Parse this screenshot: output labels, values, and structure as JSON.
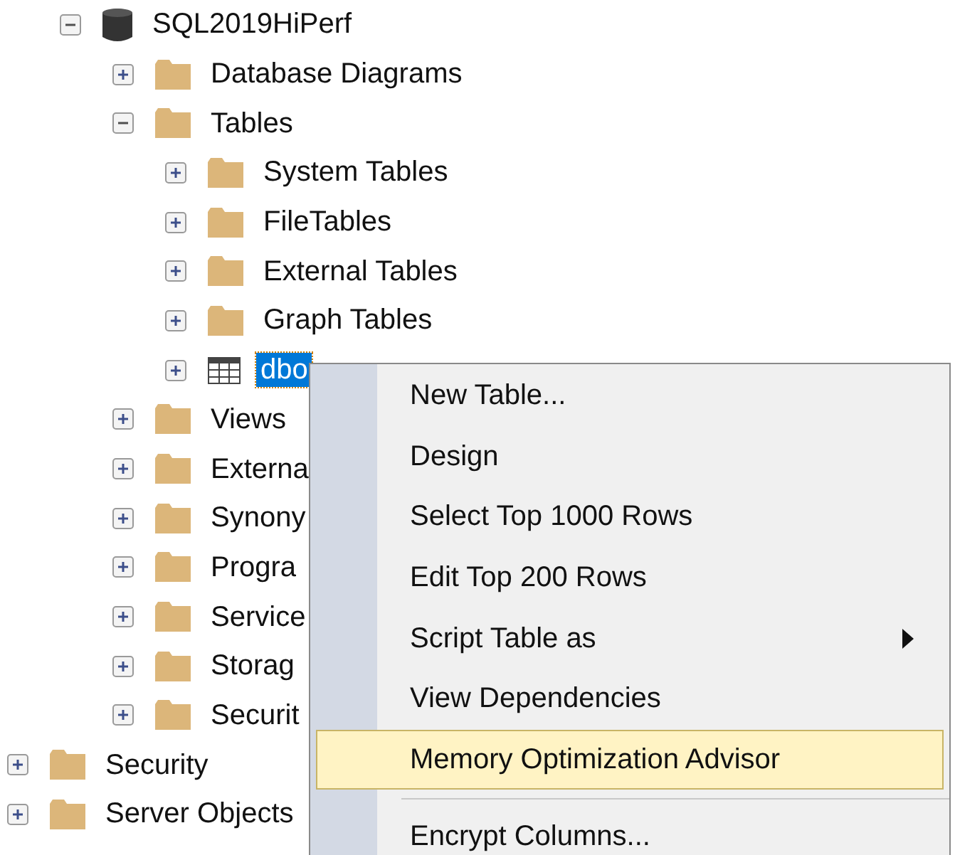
{
  "tree": [
    {
      "label": "SQL2019HiPerf",
      "kind": "database",
      "expanded": true,
      "selected": false,
      "children": [
        {
          "label": "Database Diagrams",
          "kind": "folder",
          "expanded": false,
          "selected": false
        },
        {
          "label": "Tables",
          "kind": "folder",
          "expanded": true,
          "selected": false,
          "children": [
            {
              "label": "System Tables",
              "kind": "folder",
              "expanded": false,
              "selected": false
            },
            {
              "label": "FileTables",
              "kind": "folder",
              "expanded": false,
              "selected": false
            },
            {
              "label": "External Tables",
              "kind": "folder",
              "expanded": false,
              "selected": false
            },
            {
              "label": "Graph Tables",
              "kind": "folder",
              "expanded": false,
              "selected": false
            },
            {
              "label": "dbo",
              "kind": "table",
              "expanded": false,
              "selected": true
            }
          ]
        },
        {
          "label": "Views",
          "kind": "folder",
          "expanded": false,
          "selected": false
        },
        {
          "label": "Externa",
          "kind": "folder",
          "expanded": false,
          "selected": false
        },
        {
          "label": "Synony",
          "kind": "folder",
          "expanded": false,
          "selected": false
        },
        {
          "label": "Progra",
          "kind": "folder",
          "expanded": false,
          "selected": false
        },
        {
          "label": "Service",
          "kind": "folder",
          "expanded": false,
          "selected": false
        },
        {
          "label": "Storag",
          "kind": "folder",
          "expanded": false,
          "selected": false
        },
        {
          "label": "Securit",
          "kind": "folder",
          "expanded": false,
          "selected": false
        }
      ]
    },
    {
      "label": "Security",
      "kind": "folder",
      "expanded": false,
      "selected": false
    },
    {
      "label": "Server Objects",
      "kind": "folder",
      "expanded": false,
      "selected": false
    }
  ],
  "context_menu": [
    {
      "kind": "command",
      "label": "New Table...",
      "submenu": false,
      "selected": false
    },
    {
      "kind": "command",
      "label": "Design",
      "submenu": false,
      "selected": false
    },
    {
      "kind": "command",
      "label": "Select Top 1000 Rows",
      "submenu": false,
      "selected": false
    },
    {
      "kind": "command",
      "label": "Edit Top 200 Rows",
      "submenu": false,
      "selected": false
    },
    {
      "kind": "command",
      "label": "Script Table as",
      "submenu": true,
      "selected": false
    },
    {
      "kind": "command",
      "label": "View Dependencies",
      "submenu": false,
      "selected": false
    },
    {
      "kind": "command",
      "label": "Memory Optimization Advisor",
      "submenu": false,
      "selected": true
    },
    {
      "kind": "separator"
    },
    {
      "kind": "command",
      "label": "Encrypt Columns...",
      "submenu": false,
      "selected": false
    }
  ]
}
